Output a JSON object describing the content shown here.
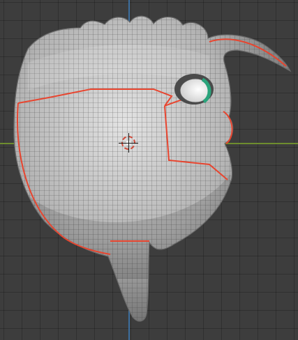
{
  "viewport": {
    "label": "3D Viewport",
    "colors": {
      "background": "#3d3d3d",
      "grid": "#2f2f2f",
      "x_axis": "#6e8d2e",
      "y_axis": "#3c6e9e",
      "mesh_base": "#b8b8b8",
      "wire": "#3a3a3a",
      "seam": "#e8452f",
      "eye_green": "#2aa37b"
    },
    "objects": [
      {
        "name": "creature-mesh",
        "kind": "subdivided-mesh",
        "shading": "solid"
      },
      {
        "name": "3d-cursor",
        "kind": "cursor"
      }
    ]
  }
}
